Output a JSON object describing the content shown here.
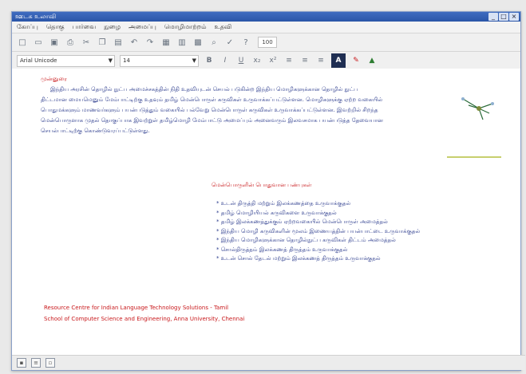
{
  "window": {
    "title": "ஊடக உலாவி",
    "controls": [
      "_",
      "□",
      "×"
    ]
  },
  "menubar": {
    "items": [
      "கோப்பு",
      "தொகு",
      "பார்வை",
      "நுழை",
      "அமைப்பு",
      "மொழிமாற்றம்",
      "உதவி"
    ]
  },
  "toolbar": {
    "zoom": "100"
  },
  "format": {
    "font": "Arial Unicode",
    "size": "14"
  },
  "document": {
    "heading": "முன்னுரை",
    "paragraph": "இந்திய அரசின் தொழில் நுட்ப அமைச்சகத்தின் நிதி உதவியுடன் செயல் படுகின்ற இந்திய மொழிகளுக்கான தொழில் நுட்ப திட்டமான மையமெனும் மேம்பாட்டிற்கு உதவும் தமிழ் மென்பொருள் கருவிகள் உருவாக்கப்பட்டுள்ளன. மொழிகளுக்கு ஏற்ற வகையில் பொதுமக்களும் மாணவர்களும் பயன்படுத்தும் வகையில் பல்வேறு மென்பொருள் கருவிகள் உருவாக்கப்பட்டுள்ளன. இவற்றில் சிறந்த மென்பொருளாக முதல் தொகுப்பாக இவற்றுள் தமிழ்மொழி மேம்பாட்டு அமைப்பும் அனைவரும் இலவசமாக பயன்படுத்த தேவையான செயல்பாட்டிற்கு கொண்டுவரப்பட்டுள்ளது.",
    "section_heading": "மென்பொருளின் பொதுவான பண்புகள்",
    "bullets": [
      "* உடன் திருத்தி மற்றும் இலக்கணத்தை உருவாக்குதல்",
      "* தமிழ் மொழியியல் கருவிகளை உருவாக்குதல்",
      "* தமிழ் இலக்கணத்துக்கும் ஏற்றவகையில் மென்பொருள் அமைத்தல்",
      "* இந்திய மொழி கருவிகளின் மூலம் இணையத்தின் பயன்பாட்டை உருவாக்குதல்",
      "* இந்திய மொழிகளுக்கான தொழில்நுட்ப கருவிகள் திட்டம் அமைத்தல்",
      "* சொல்திருத்தம் இலக்கணத் திருத்தம் உருவாக்குதல்",
      "* உடன் சொல் தேடல் மற்றும் இலக்கணத் திருத்தம் உருவாக்குதல்"
    ],
    "footer_line1": "Resource Centre for Indian Language Technology Solutions - Tamil",
    "footer_line2": "School of Computer Science and Engineering, Anna University, Chennai"
  },
  "colors": {
    "heading": "#c8181b",
    "body_text": "#2a3a8c",
    "titlebar": "#2f5bb0"
  }
}
